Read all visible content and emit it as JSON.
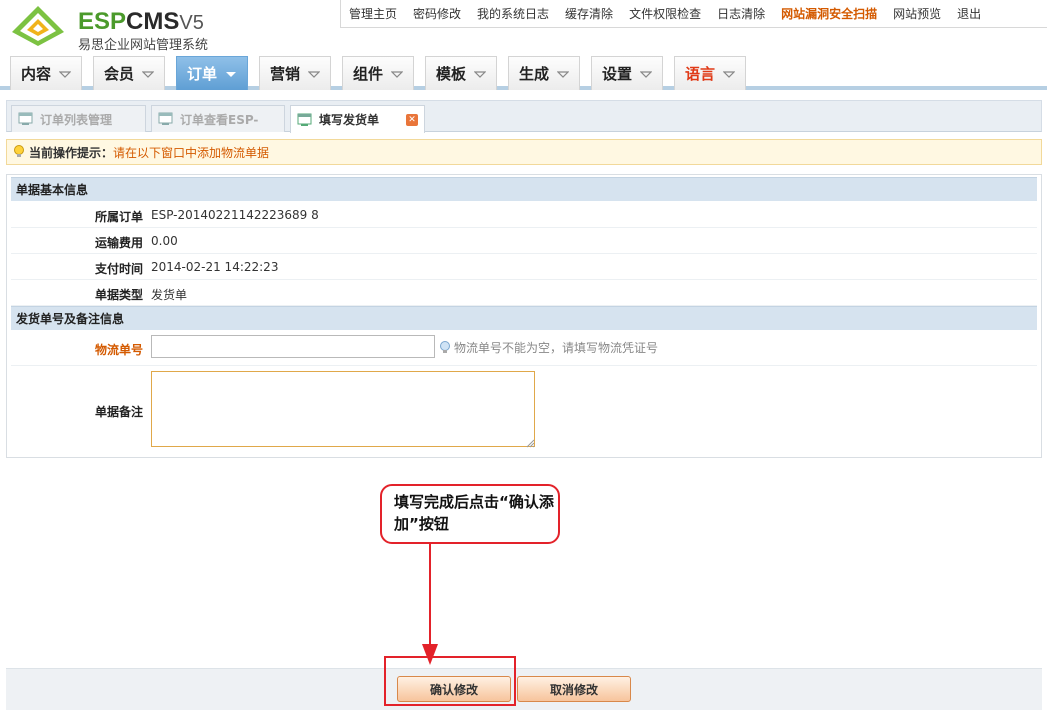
{
  "brand": {
    "esp": "ESP",
    "cms": "CMS",
    "version": "V5",
    "subtitle": "易思企业网站管理系统"
  },
  "topnav": [
    {
      "label": "管理主页",
      "warn": false
    },
    {
      "label": "密码修改",
      "warn": false
    },
    {
      "label": "我的系统日志",
      "warn": false
    },
    {
      "label": "缓存清除",
      "warn": false
    },
    {
      "label": "文件权限检查",
      "warn": false
    },
    {
      "label": "日志清除",
      "warn": false
    },
    {
      "label": "网站漏洞安全扫描",
      "warn": true
    },
    {
      "label": "网站预览",
      "warn": false
    },
    {
      "label": "退出",
      "warn": false
    }
  ],
  "mainnav": [
    {
      "label": "内容",
      "active": false
    },
    {
      "label": "会员",
      "active": false
    },
    {
      "label": "订单",
      "active": true
    },
    {
      "label": "营销",
      "active": false
    },
    {
      "label": "组件",
      "active": false
    },
    {
      "label": "模板",
      "active": false
    },
    {
      "label": "生成",
      "active": false
    },
    {
      "label": "设置",
      "active": false
    },
    {
      "label": "语言",
      "active": false
    }
  ],
  "subtabs": [
    {
      "label": "订单列表管理",
      "active": false
    },
    {
      "label": "订单查看ESP-",
      "active": false
    },
    {
      "label": "填写发货单",
      "active": true
    }
  ],
  "hint": {
    "label": "当前操作提示：",
    "message": "请在以下窗口中添加物流单据"
  },
  "section1": {
    "title": "单据基本信息",
    "rows": [
      {
        "key": "所属订单",
        "value": "ESP-20140221142223689 8"
      },
      {
        "key": "运输费用",
        "value": "0.00"
      },
      {
        "key": "支付时间",
        "value": "2014-02-21 14:22:23"
      },
      {
        "key": "单据类型",
        "value": "发货单"
      }
    ]
  },
  "section2": {
    "title": "发货单号及备注信息",
    "tracking_label": "物流单号",
    "tracking_value": "",
    "tracking_tip": "物流单号不能为空，请填写物流凭证号",
    "remark_label": "单据备注",
    "remark_value": ""
  },
  "callout": {
    "text": "填写完成后点击“确认添加”按钮"
  },
  "buttons": {
    "confirm": "确认修改",
    "cancel": "取消修改"
  },
  "colors": {
    "accent_orange": "#d45a00",
    "nav_active": "#5f9fd4",
    "annotation_red": "#e3222a",
    "brand_green": "#4b9a2b"
  }
}
